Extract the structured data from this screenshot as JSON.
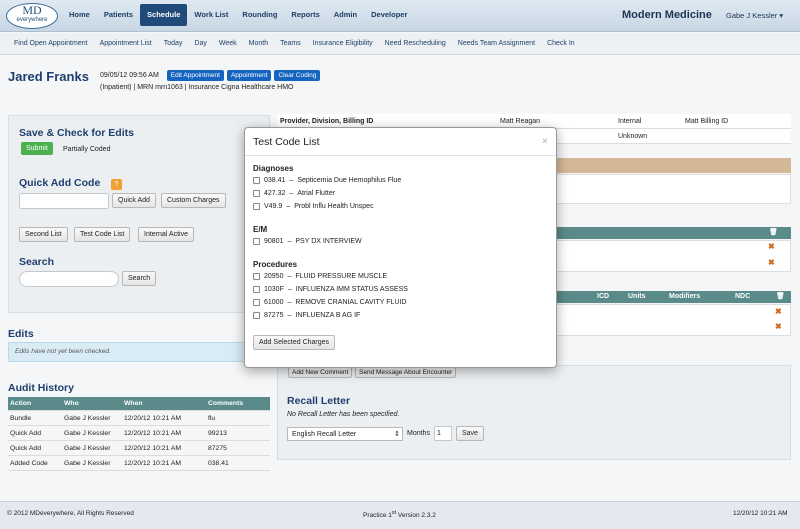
{
  "logo": {
    "line1": "MD",
    "line2": "everywhere"
  },
  "nav": [
    {
      "label": "Home",
      "active": false
    },
    {
      "label": "Patients",
      "active": false
    },
    {
      "label": "Schedule",
      "active": true
    },
    {
      "label": "Work List",
      "active": false
    },
    {
      "label": "Rounding",
      "active": false
    },
    {
      "label": "Reports",
      "active": false
    },
    {
      "label": "Admin",
      "active": false
    },
    {
      "label": "Developer",
      "active": false
    }
  ],
  "brand": "Modern Medicine",
  "user": "Gabe J Kessler",
  "subnav": [
    "Find Open Appointment",
    "Appointment List",
    "Today",
    "Day",
    "Week",
    "Month",
    "Teams",
    "Insurance Eligibility",
    "Need Rescheduling",
    "Needs Team Assignment",
    "Check In"
  ],
  "patient": {
    "name": "Jared Franks",
    "timestamp": "09/05/12 09:56 AM",
    "buttons": [
      "Edit Appointment",
      "Appointment",
      "Clear Coding"
    ],
    "details": "(Inpatient) | MRN mrn1063 | Insurance Cigna Healthcare HMO"
  },
  "save_check": {
    "title": "Save & Check for Edits",
    "submit": "Submit",
    "status": "Partially Coded"
  },
  "quick_add": {
    "title": "Quick Add Code",
    "badge": "?",
    "add_button": "Quick Add",
    "custom_button": "Custom Charges",
    "lists": [
      "Second List",
      "Test Code List",
      "Internal Active"
    ]
  },
  "search": {
    "title": "Search",
    "button": "Search"
  },
  "edits": {
    "title": "Edits",
    "message": "Edits have not yet been checked."
  },
  "audit": {
    "title": "Audit History",
    "columns": [
      "Action",
      "Who",
      "When",
      "Comments"
    ],
    "rows": [
      [
        "Bundle",
        "Gabe J Kessler",
        "12/20/12 10:21 AM",
        "flu"
      ],
      [
        "Quick Add",
        "Gabe J Kessler",
        "12/20/12 10:21 AM",
        "99213"
      ],
      [
        "Quick Add",
        "Gabe J Kessler",
        "12/20/12 10:21 AM",
        "87275"
      ],
      [
        "Added Code",
        "Gabe J Kessler",
        "12/20/12 10:21 AM",
        "038.41"
      ]
    ]
  },
  "provider_table": {
    "header": [
      "Provider, Division, Billing ID",
      "Matt Reagan",
      "Internal",
      "Matt Billing ID"
    ],
    "row2": [
      "",
      "",
      "Unknown",
      ""
    ]
  },
  "charges_table": {
    "columns": [
      "ICD",
      "Units",
      "Modifiers",
      "NDC"
    ]
  },
  "comments": {
    "add": "Add New Comment",
    "send": "Send Message About Encounter"
  },
  "recall": {
    "title": "Recall Letter",
    "status": "No Recall Letter has been specified.",
    "letter": "English Recall Letter",
    "months_label": "Months",
    "months_value": "1",
    "save": "Save"
  },
  "footer": {
    "copyright": "© 2012 MDeverywhere, All Rights Reserved",
    "version_pre": "Practice 1",
    "version_sup": "st",
    "version_post": " Version 2.3.2",
    "datetime": "12/20/12 10:21 AM"
  },
  "modal": {
    "title": "Test Code List",
    "close": "×",
    "sections": [
      {
        "heading": "Diagnoses",
        "items": [
          {
            "code": "038.41",
            "desc": "Septicemia Due Hemophilus Flue"
          },
          {
            "code": "427.32",
            "desc": "Atrial Flutter"
          },
          {
            "code": "V49.9",
            "desc": "Probl Influ Health Unspec"
          }
        ]
      },
      {
        "heading": "E/M",
        "items": [
          {
            "code": "90801",
            "desc": "PSY DX INTERVIEW"
          }
        ]
      },
      {
        "heading": "Procedures",
        "items": [
          {
            "code": "20950",
            "desc": "FLUID PRESSURE MUSCLE"
          },
          {
            "code": "1030F",
            "desc": "INFLUENZA IMM STATUS ASSESS"
          },
          {
            "code": "61000",
            "desc": "REMOVE CRANIAL CAVITY FLUID"
          },
          {
            "code": "87275",
            "desc": "INFLUENZA B AG IF"
          }
        ]
      }
    ],
    "add_button": "Add Selected Charges"
  }
}
